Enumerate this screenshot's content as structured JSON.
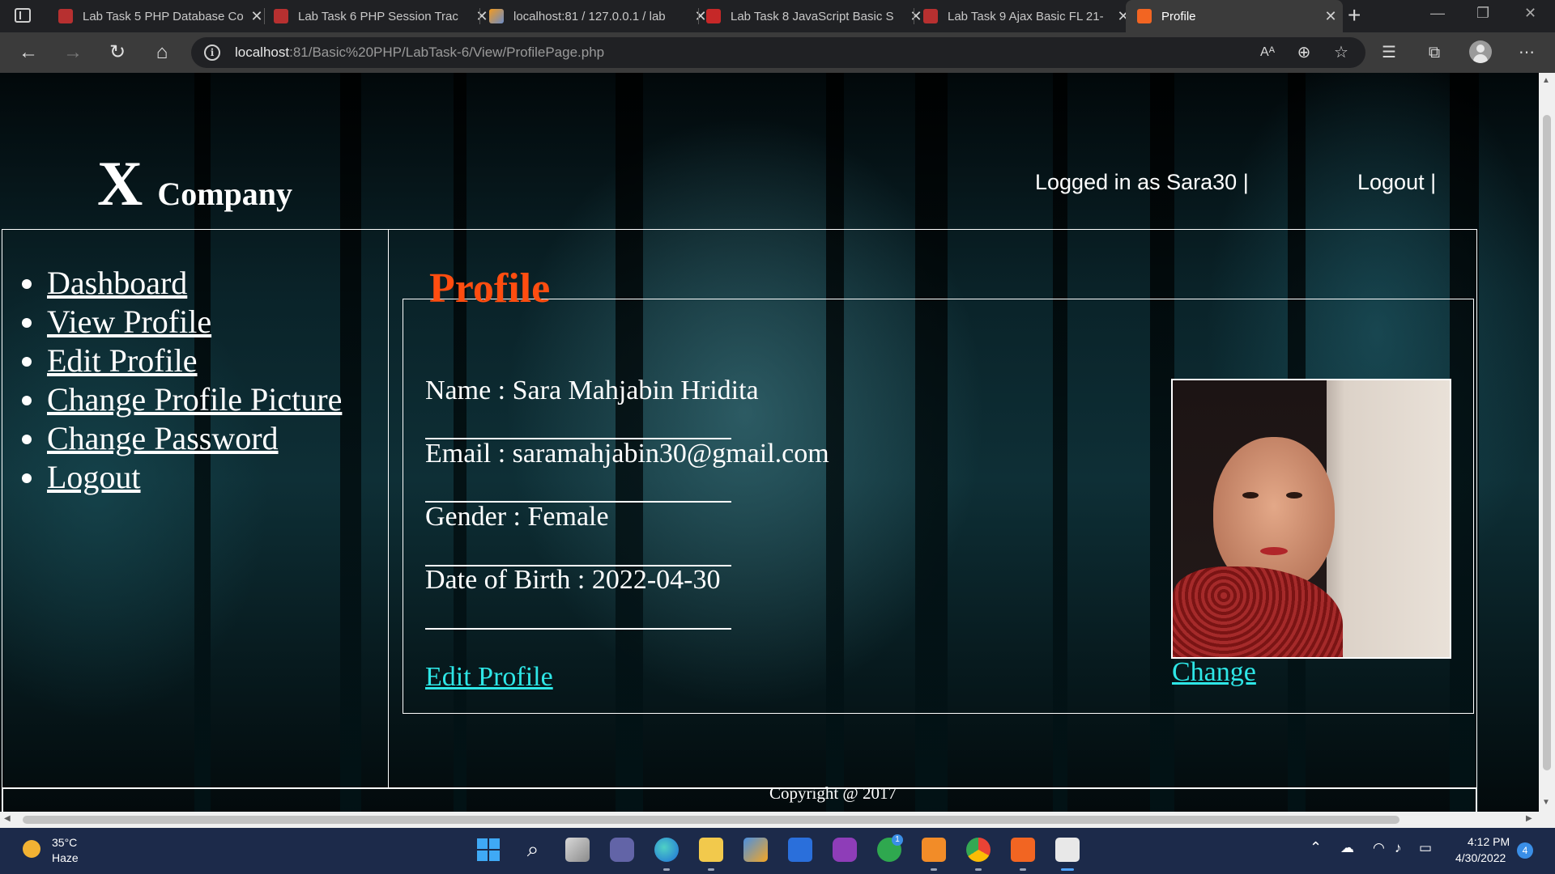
{
  "browser": {
    "tabs": [
      {
        "title": "Lab Task 5 PHP Database Co",
        "favicon": "pdf-icon"
      },
      {
        "title": "Lab Task 6 PHP Session Trac",
        "favicon": "pdf-icon"
      },
      {
        "title": "localhost:81 / 127.0.0.1 / lab",
        "favicon": "phpmyadmin-icon"
      },
      {
        "title": "Lab Task 8 JavaScript Basic S",
        "favicon": "pdf-icon"
      },
      {
        "title": "Lab Task 9 Ajax Basic FL 21-",
        "favicon": "pdf-icon"
      },
      {
        "title": "Profile",
        "favicon": "xampp-icon",
        "active": true
      }
    ],
    "url_host": "localhost",
    "url_rest": ":81/Basic%20PHP/LabTask-6/View/ProfilePage.php",
    "new_tab_label": "+",
    "close_glyph": "✕"
  },
  "page": {
    "logo_mark": "X",
    "logo_name": "Company",
    "logged_in_text": "Logged in as Sara30 |",
    "header_logout": "Logout |",
    "sidebar": {
      "items": [
        {
          "label": "Dashboard"
        },
        {
          "label": "View Profile"
        },
        {
          "label": "Edit Profile"
        },
        {
          "label": "Change Profile Picture"
        },
        {
          "label": "Change Password"
        },
        {
          "label": "Logout"
        }
      ]
    },
    "profile": {
      "legend": "Profile",
      "name_line": "Name : Sara Mahjabin Hridita",
      "email_line": "Email : saramahjabin30@gmail.com",
      "gender_line": "Gender : Female",
      "dob_line": "Date of Birth : 2022-04-30",
      "edit_link": "Edit Profile",
      "change_link": "Change"
    },
    "footer": "Copyright @ 2017"
  },
  "taskbar": {
    "weather_temp": "35°C",
    "weather_desc": "Haze",
    "time": "4:12 PM",
    "date": "4/30/2022",
    "notifications": "4",
    "xbox_badge": "1"
  },
  "colors": {
    "legend": "#ff4d10",
    "link": "#2ee6e6",
    "taskbar": "#1c2a4a"
  }
}
